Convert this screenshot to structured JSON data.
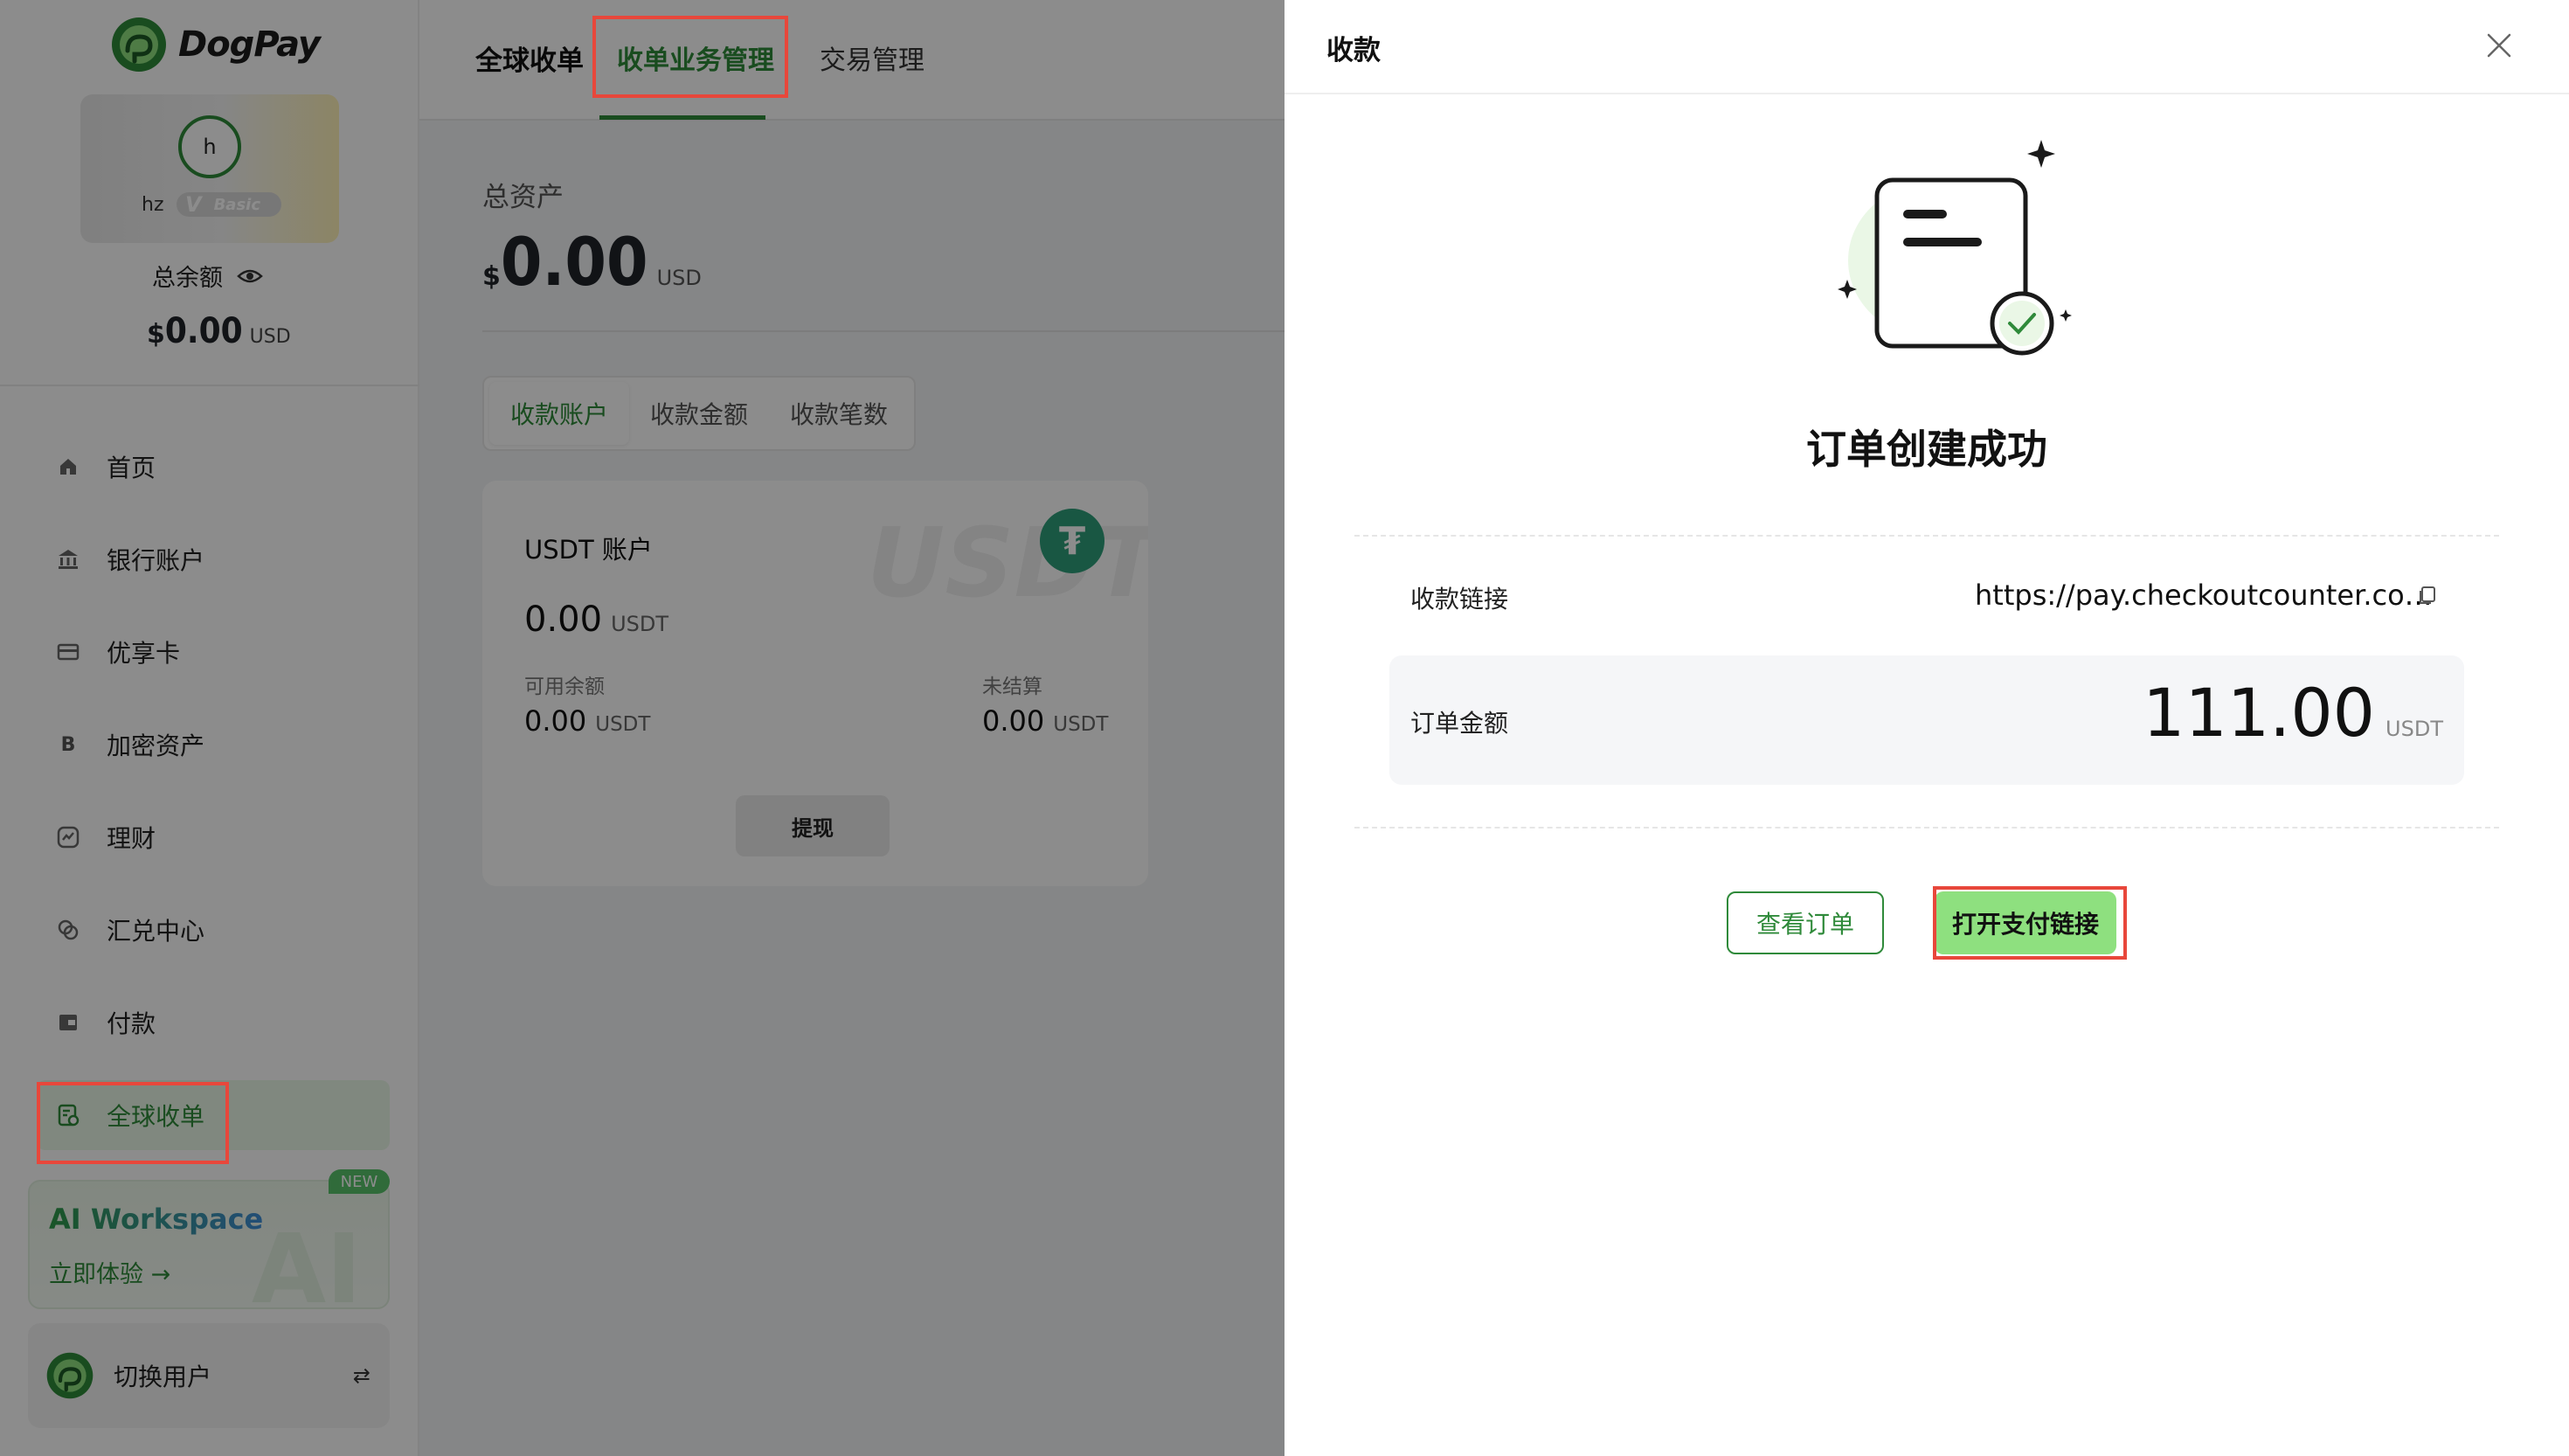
{
  "app": {
    "logo_text": "DogPay"
  },
  "user": {
    "avatar_initial": "h",
    "name": "hz",
    "tier": "Basic"
  },
  "sidebar": {
    "balance_label": "总余额",
    "balance_currency": "$",
    "balance_value": "0.00",
    "balance_unit": "USD",
    "items": [
      {
        "label": "首页",
        "icon": "home-icon"
      },
      {
        "label": "银行账户",
        "icon": "bank-icon"
      },
      {
        "label": "优享卡",
        "icon": "card-icon"
      },
      {
        "label": "加密资产",
        "icon": "bitcoin-icon"
      },
      {
        "label": "理财",
        "icon": "finance-icon"
      },
      {
        "label": "汇兑中心",
        "icon": "exchange-icon"
      },
      {
        "label": "付款",
        "icon": "wallet-icon"
      },
      {
        "label": "全球收单",
        "icon": "receipt-icon",
        "active": true
      }
    ],
    "ai_card": {
      "title": "AI Workspace",
      "cta": "立即体验",
      "badge": "NEW",
      "watermark": "AI"
    },
    "switch_user": {
      "label": "切换用户",
      "icon": "swap-icon"
    }
  },
  "main": {
    "tabs": [
      "全球收单",
      "收单业务管理",
      "交易管理"
    ],
    "assets_label": "总资产",
    "assets_currency": "$",
    "assets_value": "0.00",
    "assets_unit": "USD",
    "segments": [
      "收款账户",
      "收款金额",
      "收款笔数"
    ],
    "card": {
      "title": "USDT 账户",
      "watermark": "USDT",
      "balance": "0.00",
      "unit": "USDT",
      "available_label": "可用余额",
      "available_value": "0.00",
      "unsettled_label": "未结算",
      "unsettled_value": "0.00",
      "withdraw_label": "提现"
    }
  },
  "drawer": {
    "title": "收款",
    "success_title": "订单创建成功",
    "link_label": "收款链接",
    "link_value": "https://pay.checkoutcounter.com/",
    "amount_label": "订单金额",
    "amount_value": "111.00",
    "amount_unit": "USDT",
    "view_order_label": "查看订单",
    "open_link_label": "打开支付链接"
  },
  "colors": {
    "accent": "#2f8a3a",
    "primary_button": "#8ee07f",
    "annotation": "#e8473b",
    "tether": "#2f9e7a"
  }
}
